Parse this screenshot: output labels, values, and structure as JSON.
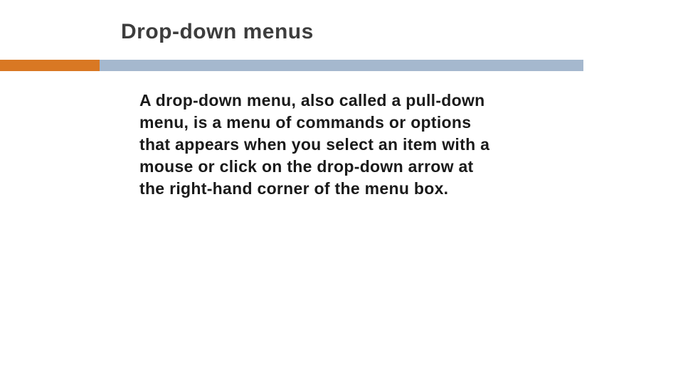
{
  "slide": {
    "title": "Drop-down menus",
    "body": "A drop-down menu, also called a pull-down menu, is a menu of commands or options that appears when you select an item with a mouse or click on the drop-down arrow at the right-hand corner of the menu box."
  },
  "colors": {
    "accent": "#d97823",
    "bar": "#a5b8ce"
  }
}
